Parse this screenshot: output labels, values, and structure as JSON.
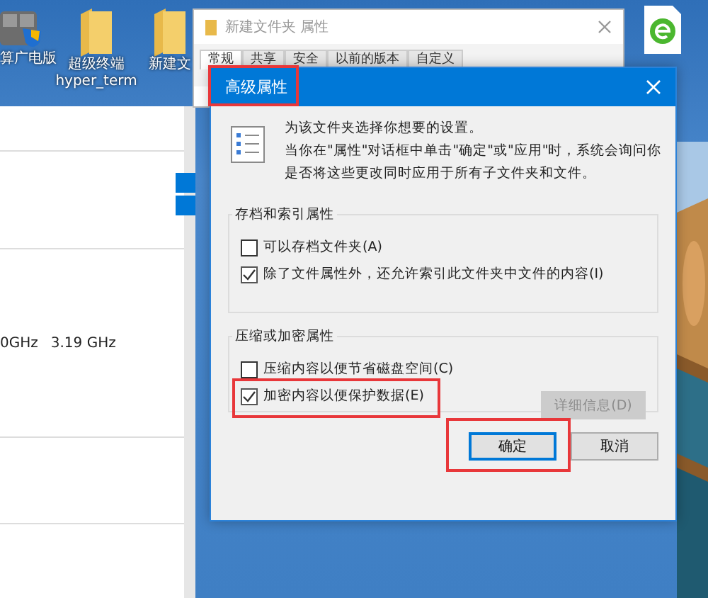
{
  "desktop_icons": [
    {
      "kind": "calculator",
      "lines": [
        "算广电版"
      ]
    },
    {
      "kind": "folder",
      "lines": [
        "超级终端",
        "hyper_term"
      ]
    },
    {
      "kind": "folder",
      "lines": [
        "新建文"
      ]
    },
    {
      "kind": "browser"
    }
  ],
  "background_app": {
    "cells": [
      "0GHz",
      "3.19 GHz"
    ]
  },
  "properties_window": {
    "title": "新建文件夹 属性",
    "tabs": [
      {
        "label": "常规",
        "selected": true
      },
      {
        "label": "共享",
        "selected": false
      },
      {
        "label": "安全",
        "selected": false
      },
      {
        "label": "以前的版本",
        "selected": false
      },
      {
        "label": "自定义",
        "selected": false
      }
    ]
  },
  "dialog": {
    "title": "高级属性",
    "title_highlighted": true,
    "intro": "为该文件夹选择你想要的设置。",
    "note": "当你在\"属性\"对话框中单击\"确定\"或\"应用\"时，系统会询问你是否将这些更改同时应用于所有子文件夹和文件。",
    "groups": [
      {
        "title": "存档和索引属性",
        "options": [
          {
            "label": "可以存档文件夹(A)",
            "checked": false,
            "highlighted": false
          },
          {
            "label": "除了文件属性外，还允许索引此文件夹中文件的内容(I)",
            "checked": true,
            "highlighted": false
          }
        ]
      },
      {
        "title": "压缩或加密属性",
        "options": [
          {
            "label": "压缩内容以便节省磁盘空间(C)",
            "checked": false,
            "highlighted": false
          },
          {
            "label": "加密内容以便保护数据(E)",
            "checked": true,
            "highlighted": true
          }
        ],
        "details_button": {
          "label": "详细信息(D)",
          "disabled": true
        }
      }
    ],
    "buttons": [
      {
        "label": "确定",
        "default": true,
        "highlighted": true
      },
      {
        "label": "取消",
        "default": false,
        "highlighted": false
      }
    ]
  }
}
